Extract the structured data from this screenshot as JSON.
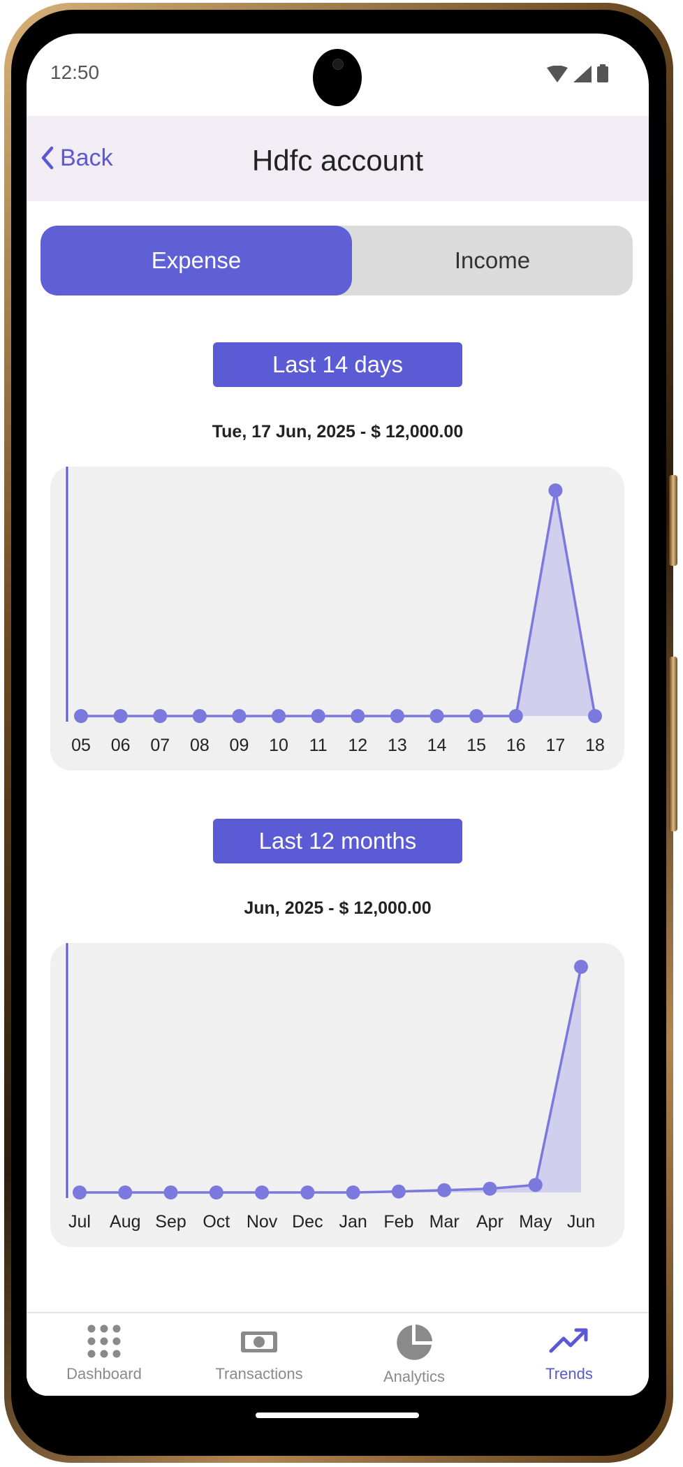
{
  "status_bar": {
    "time": "12:50"
  },
  "header": {
    "back_label": "Back",
    "title": "Hdfc account"
  },
  "segment": {
    "expense_label": "Expense",
    "income_label": "Income",
    "selected": "Expense"
  },
  "colors": {
    "accent": "#5b5bd6",
    "line": "#7b78de",
    "area": "#c9c7ee",
    "chart_bg": "#f0f0f0"
  },
  "daily": {
    "range_label": "Last 14 days",
    "summary": "Tue, 17 Jun, 2025 - $ 12,000.00"
  },
  "monthly": {
    "range_label": "Last 12 months",
    "summary": "Jun, 2025 - $ 12,000.00"
  },
  "chart_data": [
    {
      "type": "area",
      "categories": [
        "05",
        "06",
        "07",
        "08",
        "09",
        "10",
        "11",
        "12",
        "13",
        "14",
        "15",
        "16",
        "17",
        "18"
      ],
      "values": [
        0,
        0,
        0,
        0,
        0,
        0,
        0,
        0,
        0,
        0,
        0,
        0,
        12000,
        0
      ],
      "ylim": [
        0,
        12000
      ],
      "grid": false,
      "legend": "none"
    },
    {
      "type": "area",
      "categories": [
        "Jul",
        "Aug",
        "Sep",
        "Oct",
        "Nov",
        "Dec",
        "Jan",
        "Feb",
        "Mar",
        "Apr",
        "May",
        "Jun"
      ],
      "values": [
        0,
        0,
        0,
        0,
        0,
        0,
        0,
        50,
        120,
        200,
        400,
        12000
      ],
      "ylim": [
        0,
        12000
      ],
      "grid": false,
      "legend": "none"
    }
  ],
  "tabs": [
    {
      "label": "Dashboard",
      "icon": "grid-dots-icon",
      "active": false
    },
    {
      "label": "Transactions",
      "icon": "banknote-icon",
      "active": false
    },
    {
      "label": "Analytics",
      "icon": "pie-chart-icon",
      "active": false
    },
    {
      "label": "Trends",
      "icon": "trend-up-icon",
      "active": true
    }
  ]
}
